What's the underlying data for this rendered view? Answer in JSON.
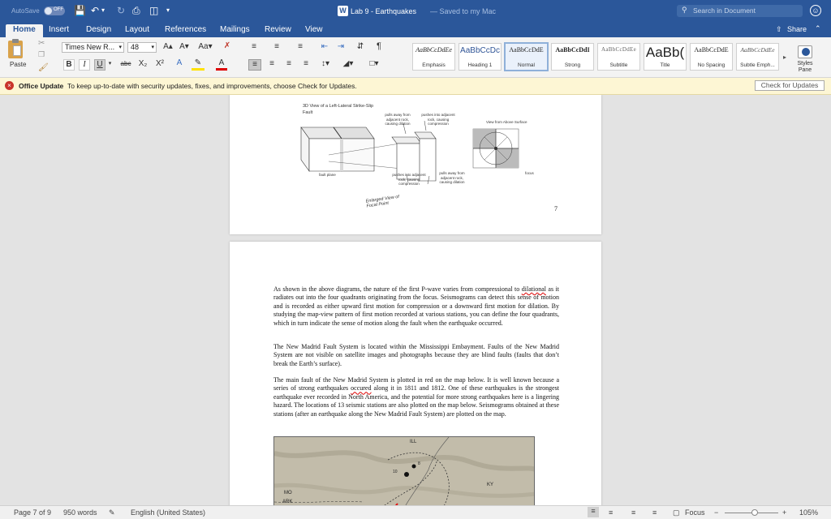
{
  "title_bar": {
    "autosave_label": "AutoSave",
    "autosave_state": "OFF",
    "doc_title": "Lab 9 - Earthquakes",
    "saved_status": "— Saved to my Mac",
    "search_placeholder": "Search in Document"
  },
  "tabs": [
    "Home",
    "Insert",
    "Design",
    "Layout",
    "References",
    "Mailings",
    "Review",
    "View"
  ],
  "share_label": "Share",
  "ribbon": {
    "paste_label": "Paste",
    "font_name": "Times New R...",
    "font_size": "48",
    "styles": [
      {
        "sample": "AaBbCcDdEe",
        "name": "Emphasis"
      },
      {
        "sample": "AaBbCcDc",
        "name": "Heading 1"
      },
      {
        "sample": "AaBbCcDdE",
        "name": "Normal"
      },
      {
        "sample": "AaBbCcDdI",
        "name": "Strong"
      },
      {
        "sample": "AaBbCcDdEe",
        "name": "Subtitle"
      },
      {
        "sample": "AaBb(",
        "name": "Title"
      },
      {
        "sample": "AaBbCcDdE",
        "name": "No Spacing"
      },
      {
        "sample": "AaBbCcDdEe",
        "name": "Subtle Emph..."
      }
    ],
    "styles_pane_label": "Styles Pane"
  },
  "notice": {
    "title": "Office Update",
    "message": "To keep up-to-date with security updates, fixes, and improvements, choose Check for Updates.",
    "button": "Check for Updates"
  },
  "page1": {
    "figure_title": "3D View of a Left-Lateral Strike-Slip Fault",
    "enlarged_label": "Enlarged View of Focal Point",
    "label_pulls_top": "pulls away from adjacent rock, causing dilation",
    "label_pushes_top": "pushes into adjacent rock, causing compression",
    "label_pushes_bottom": "pushes into adjacent rock, causing compression",
    "label_pulls_bottom": "pulls away from adjacent rock, causing dilation",
    "label_view_above": "View from Above Surface",
    "label_fault_plane": "fault plane",
    "label_focus": "focus",
    "page_number": "7"
  },
  "page2": {
    "paragraphs": [
      {
        "lead": "As shown in the above diagrams, the nature of the first P-wave varies from compressional to ",
        "flag": "dilational",
        "trail": " as it radiates out into the four quadrants originating from the focus. Seismograms can detect this sense of motion and is recorded as either upward first motion for compression or a downward first motion for dilation. By studying the map-view pattern of first motion recorded at various stations, you can define the four quadrants, which in turn indicate the sense of motion along the fault when the earthquake occurred."
      },
      {
        "lead": "The New Madrid Fault System is located within the Mississippi Embayment. Faults of the New Madrid System are not visible on satellite images and photographs because they are blind faults (faults that don’t break the Earth’s surface).",
        "flag": "",
        "trail": ""
      },
      {
        "lead": "The main fault of the New Madrid System is plotted in red on the map below. It is well known because a series of strong earthquakes ",
        "flag": "occured",
        "trail": " along it in 1811 and 1812. One of these earthquakes is the strongest earthquake ever recorded in North America, and the potential for more strong earthquakes here is a lingering hazard. The locations of 13 seismic stations are also plotted on the map below. Seismograms obtained at these stations (after an earthquake along the New Madrid Fault System) are plotted on the map."
      }
    ],
    "map_labels": {
      "ill": "ILL",
      "ky": "KY",
      "mo": "MO",
      "ark": "ARK",
      "station_a": "10",
      "station_b": "8"
    }
  },
  "status": {
    "page": "Page 7 of 9",
    "words": "950 words",
    "language": "English (United States)",
    "focus": "Focus",
    "zoom": "105%"
  }
}
